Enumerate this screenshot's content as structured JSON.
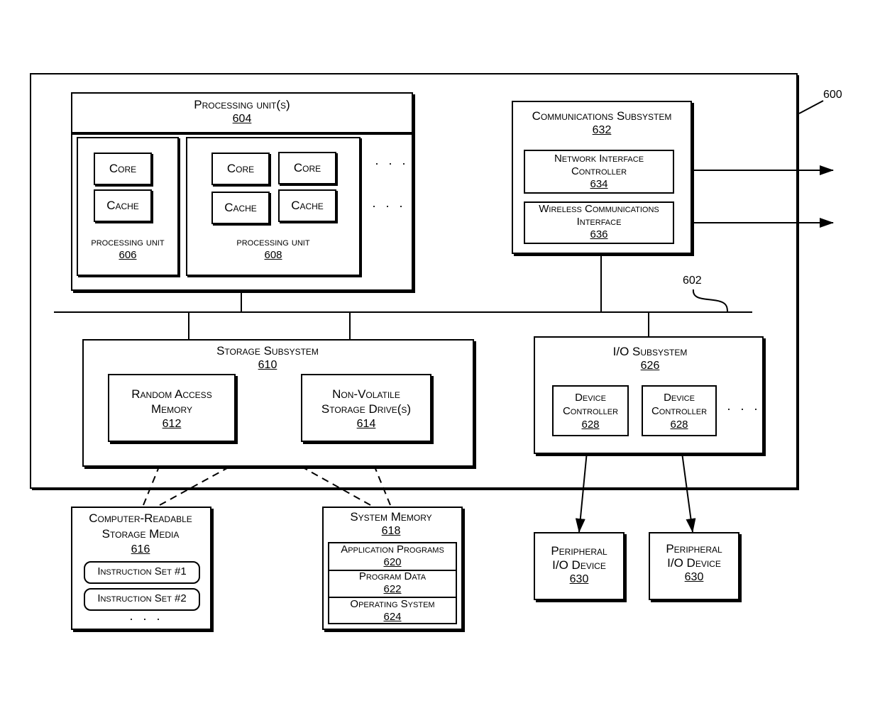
{
  "diagram": {
    "system_ref": "600",
    "bus_ref": "602",
    "processing_units": {
      "title": "Processing unit(s)",
      "ref": "604",
      "units": [
        {
          "title": "processing unit",
          "ref": "606",
          "cores": [
            {
              "label": "Core"
            }
          ],
          "caches": [
            {
              "label": "Cache"
            }
          ]
        },
        {
          "title": "processing unit",
          "ref": "608",
          "cores": [
            {
              "label": "Core"
            },
            {
              "label": "Core"
            }
          ],
          "caches": [
            {
              "label": "Cache"
            },
            {
              "label": "Cache"
            }
          ]
        }
      ],
      "ellipsis": "· · ·"
    },
    "communications": {
      "title": "Communications Subsystem",
      "ref": "632",
      "items": [
        {
          "title_line1": "Network Interface",
          "title_line2": "Controller",
          "ref": "634"
        },
        {
          "title_line1": "Wireless Communications",
          "title_line2": "Interface",
          "ref": "636"
        }
      ]
    },
    "storage": {
      "title": "Storage Subsystem",
      "ref": "610",
      "items": [
        {
          "title_line1": "Random Access",
          "title_line2": "Memory",
          "ref": "612"
        },
        {
          "title_line1": "Non-Volatile",
          "title_line2": "Storage Drive(s)",
          "ref": "614"
        }
      ]
    },
    "io": {
      "title": "I/O Subsystem",
      "ref": "626",
      "controllers": [
        {
          "title_line1": "Device",
          "title_line2": "Controller",
          "ref": "628"
        },
        {
          "title_line1": "Device",
          "title_line2": "Controller",
          "ref": "628"
        }
      ],
      "ellipsis": "· · ·"
    },
    "storage_media": {
      "title_line1": "Computer-Readable",
      "title_line2": "Storage Media",
      "ref": "616",
      "instruction_sets": [
        "Instruction Set #1",
        "Instruction Set #2"
      ],
      "ellipsis": "· · ·"
    },
    "system_memory": {
      "title": "System Memory",
      "ref": "618",
      "sections": [
        {
          "title": "Application Programs",
          "ref": "620"
        },
        {
          "title": "Program Data",
          "ref": "622"
        },
        {
          "title": "Operating System",
          "ref": "624"
        }
      ]
    },
    "peripherals": [
      {
        "title_line1": "Peripheral",
        "title_line2": "I/O Device",
        "ref": "630"
      },
      {
        "title_line1": "Peripheral",
        "title_line2": "I/O Device",
        "ref": "630"
      }
    ]
  }
}
